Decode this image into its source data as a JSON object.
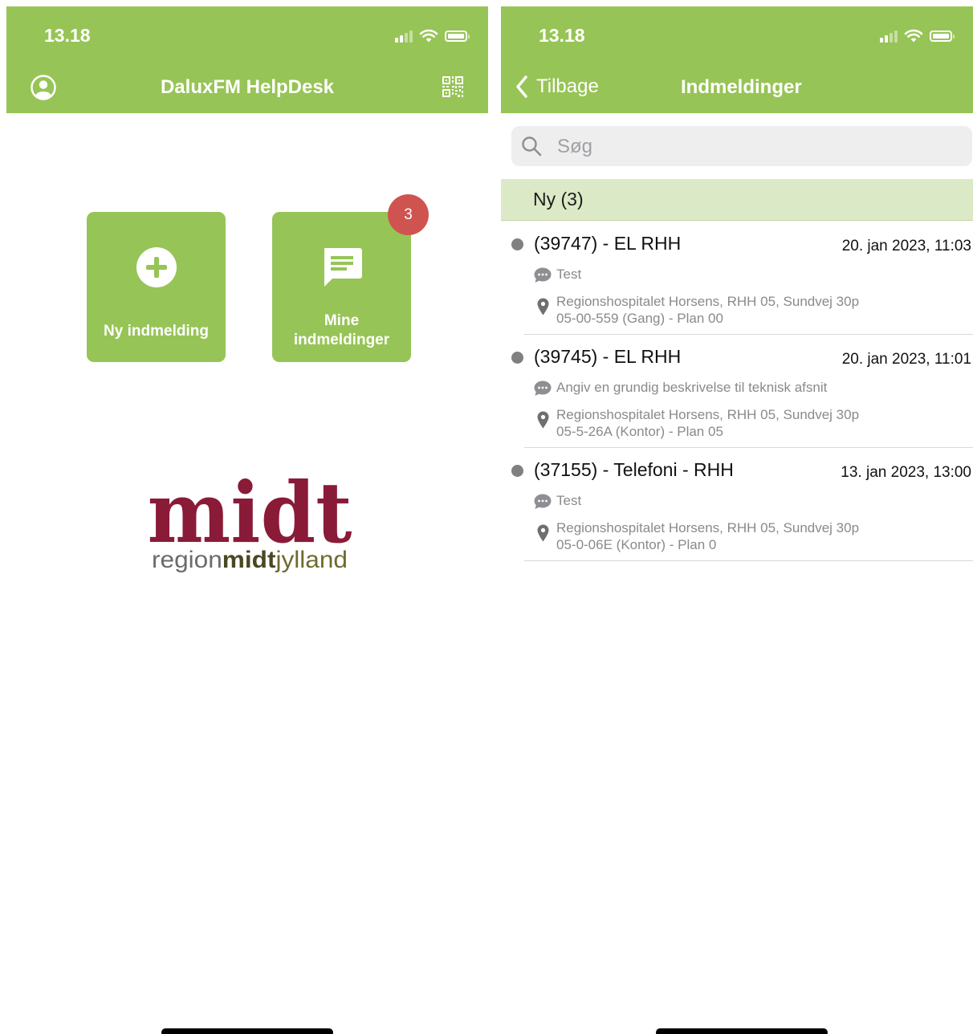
{
  "colors": {
    "brand_green": "#97c456",
    "header_section": "#dce9c6",
    "badge_red": "#cf5450",
    "logo_maroon": "#8a1b38",
    "logo_text": "#6b6b6b",
    "logo_olive": "#6f6a2f"
  },
  "home": {
    "status": {
      "time": "13.18"
    },
    "title": "DaluxFM HelpDesk",
    "icons": {
      "profile": "profile-icon",
      "qr": "qr-code-icon"
    },
    "tiles": [
      {
        "label": "Ny indmelding",
        "icon": "plus-circle-icon"
      },
      {
        "label_line1": "Mine",
        "label_line2": "indmeldinger",
        "icon": "chat-icon",
        "badge": "3"
      }
    ],
    "logo": {
      "word": "midt",
      "sub_pre": "region",
      "sub_bold": "midt",
      "sub_post": "jylland"
    }
  },
  "list": {
    "status": {
      "time": "13.18"
    },
    "back_label": "Tilbage",
    "title": "Indmeldinger",
    "search": {
      "placeholder": "Søg",
      "value": ""
    },
    "section": "Ny (3)",
    "items": [
      {
        "title": "(39747) - EL RHH",
        "date": "20. jan 2023, 11:03",
        "comment": "Test",
        "location": "Regionshospitalet Horsens, RHH 05, Sundvej 30p",
        "room": "05-00-559 (Gang) - Plan 00"
      },
      {
        "title": "(39745) - EL RHH",
        "date": "20. jan 2023, 11:01",
        "comment": "Angiv en grundig beskrivelse til teknisk afsnit",
        "location": "Regionshospitalet Horsens, RHH 05, Sundvej 30p",
        "room": "05-5-26A (Kontor) - Plan 05"
      },
      {
        "title": "(37155) - Telefoni - RHH",
        "date": "13. jan 2023, 13:00",
        "comment": "Test",
        "location": "Regionshospitalet Horsens, RHH 05, Sundvej 30p",
        "room": "05-0-06E (Kontor) - Plan 0"
      }
    ]
  }
}
